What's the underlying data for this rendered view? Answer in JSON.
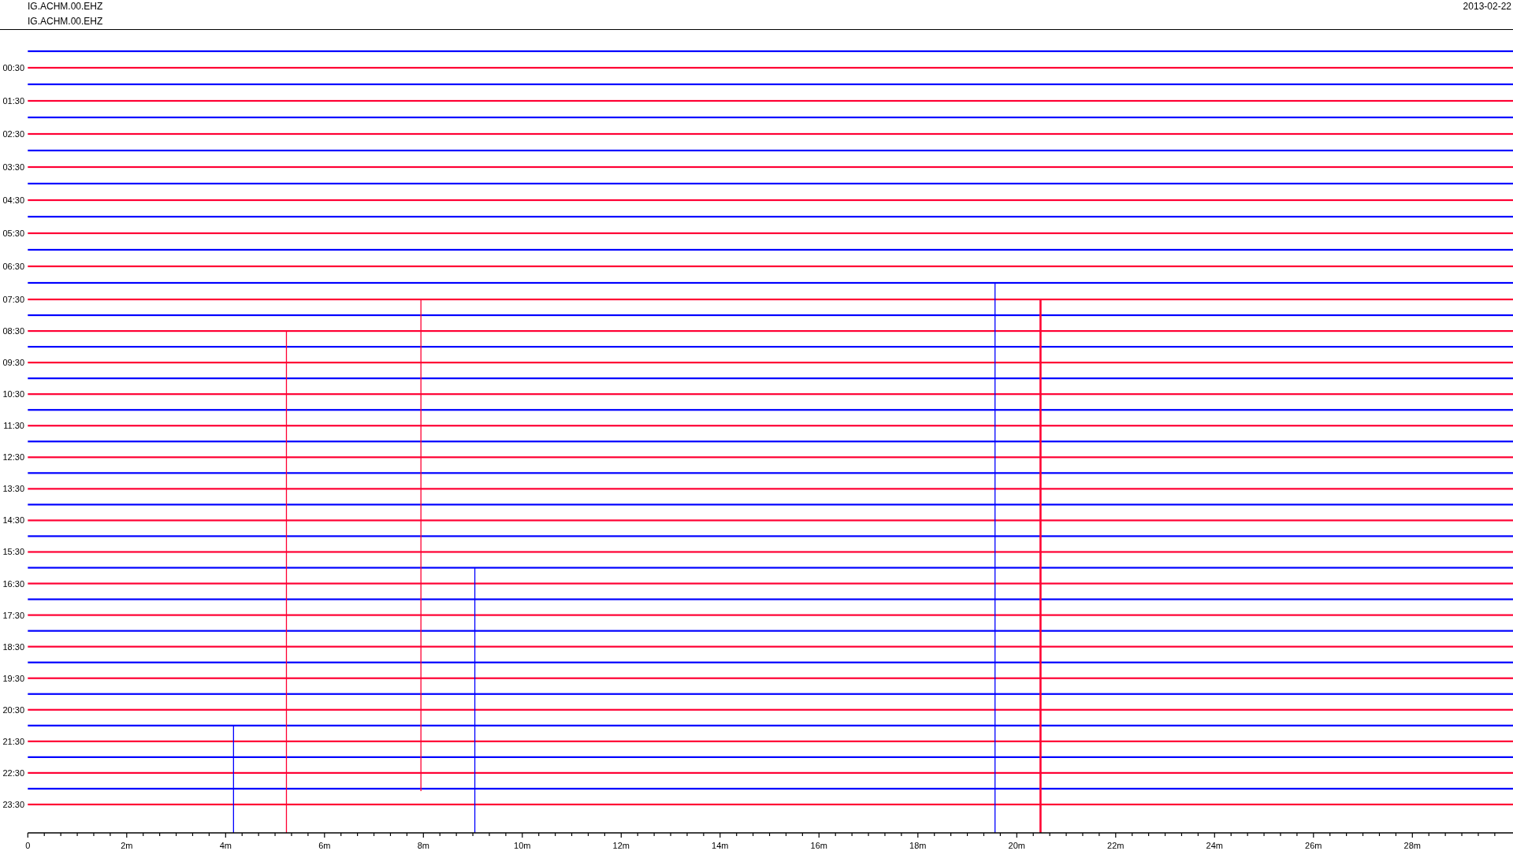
{
  "header": {
    "station_lines": [
      "IG.ACHM.00.EHZ",
      "IG.ACHM.00.EHZ"
    ],
    "date": "2013-02-22"
  },
  "plot": {
    "traces": [
      {
        "color": "#0000ff"
      },
      {
        "label": "00:30",
        "color": "#ff0033"
      },
      {
        "color": "#0000ff"
      },
      {
        "label": "01:30",
        "color": "#ff0033"
      },
      {
        "color": "#0000ff"
      },
      {
        "label": "02:30",
        "color": "#ff0033"
      },
      {
        "color": "#0000ff"
      },
      {
        "label": "03:30",
        "color": "#ff0033"
      },
      {
        "color": "#0000ff"
      },
      {
        "label": "04:30",
        "color": "#ff0033"
      },
      {
        "color": "#0000ff"
      },
      {
        "label": "05:30",
        "color": "#ff0033"
      },
      {
        "color": "#0000ff"
      },
      {
        "label": "06:30",
        "color": "#ff0033"
      },
      {
        "color": "#0000ff"
      },
      {
        "label": "07:30",
        "color": "#ff0033"
      },
      {
        "color": "#0000ff"
      },
      {
        "label": "08:30",
        "color": "#ff0033"
      },
      {
        "color": "#0000ff"
      },
      {
        "label": "09:30",
        "color": "#ff0033"
      },
      {
        "color": "#0000ff"
      },
      {
        "label": "10:30",
        "color": "#ff0033"
      },
      {
        "color": "#0000ff"
      },
      {
        "label": "11:30",
        "color": "#ff0033"
      },
      {
        "color": "#0000ff"
      },
      {
        "label": "12:30",
        "color": "#ff0033"
      },
      {
        "color": "#0000ff"
      },
      {
        "label": "13:30",
        "color": "#ff0033"
      },
      {
        "color": "#0000ff"
      },
      {
        "label": "14:30",
        "color": "#ff0033"
      },
      {
        "color": "#0000ff"
      },
      {
        "label": "15:30",
        "color": "#ff0033"
      },
      {
        "color": "#0000ff"
      },
      {
        "label": "16:30",
        "color": "#ff0033"
      },
      {
        "color": "#0000ff"
      },
      {
        "label": "17:30",
        "color": "#ff0033"
      },
      {
        "color": "#0000ff"
      },
      {
        "label": "18:30",
        "color": "#ff0033"
      },
      {
        "color": "#0000ff"
      },
      {
        "label": "19:30",
        "color": "#ff0033"
      },
      {
        "color": "#0000ff"
      },
      {
        "label": "20:30",
        "color": "#ff0033"
      },
      {
        "color": "#0000ff"
      },
      {
        "label": "21:30",
        "color": "#ff0033"
      },
      {
        "color": "#0000ff"
      },
      {
        "label": "22:30",
        "color": "#ff0033"
      },
      {
        "color": "#0000ff"
      },
      {
        "label": "23:30",
        "color": "#ff0033"
      }
    ],
    "x_ticks": [
      "0",
      "2m",
      "4m",
      "6m",
      "8m",
      "10m",
      "12m",
      "14m",
      "16m",
      "18m",
      "20m",
      "22m",
      "24m",
      "26m",
      "28m"
    ]
  }
}
